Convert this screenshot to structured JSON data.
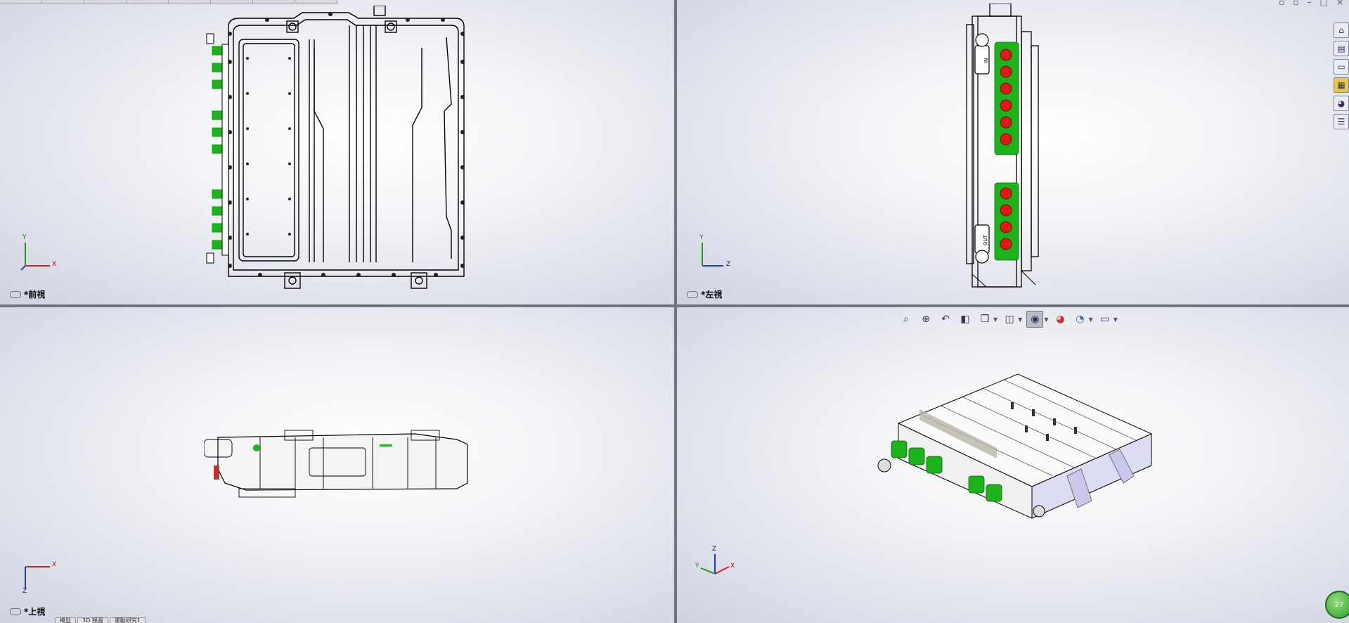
{
  "viewports": {
    "front": {
      "label": "*前視",
      "triad_h": "X",
      "triad_v": "Y"
    },
    "left": {
      "label": "*左視",
      "triad_h": "Z",
      "triad_v": "Y"
    },
    "top": {
      "label": "*上視",
      "triad_h": "X",
      "triad_v": "Z"
    },
    "iso": {
      "triad_h": "X",
      "triad_v": "Z",
      "triad_d": "Y"
    }
  },
  "left_panel": {
    "connector_labels": [
      "IN",
      "OUT"
    ]
  },
  "bottom_tabs": [
    "模型",
    "3D 視圖",
    "運動研究1"
  ],
  "zoom_bubble": "27",
  "task_pane_icons": [
    "home-icon",
    "parts-library-icon",
    "file-explorer-icon",
    "view-palette-icon",
    "appearances-icon",
    "custom-properties-icon"
  ],
  "hud_icons": [
    "zoom-to-fit-icon",
    "zoom-to-area-icon",
    "previous-view-icon",
    "section-view-icon",
    "view-orientation-icon",
    "display-style-icon",
    "hide-show-items-icon",
    "edit-appearance-icon",
    "apply-scene-icon",
    "view-settings-icon"
  ],
  "colors": {
    "connector_green": "#1db31d",
    "plug_red": "#e01818",
    "accent_lavender": "#c9c8ec"
  }
}
